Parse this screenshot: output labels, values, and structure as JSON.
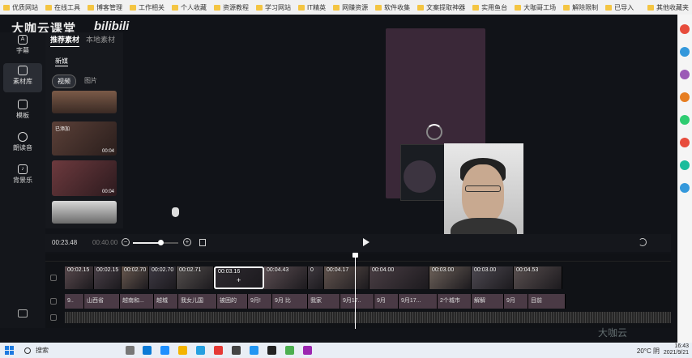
{
  "bookmarks": [
    {
      "label": "优质网站"
    },
    {
      "label": "在线工具"
    },
    {
      "label": "博客管理"
    },
    {
      "label": "工作相关"
    },
    {
      "label": "个人收藏"
    },
    {
      "label": "资源教程"
    },
    {
      "label": "学习网站"
    },
    {
      "label": "IT精英"
    },
    {
      "label": "网赚资源"
    },
    {
      "label": "软件收集"
    },
    {
      "label": "文案提取神器"
    },
    {
      "label": "实用鱼台"
    },
    {
      "label": "大咖哥工场"
    },
    {
      "label": "解除限制"
    },
    {
      "label": "已导入"
    }
  ],
  "bookmarks_right": "其他收藏夹",
  "app": {
    "brand": "大咖云课堂",
    "brand_logo": "bilibili"
  },
  "rail": [
    {
      "label": "字幕",
      "icon": "subtitle-icon"
    },
    {
      "label": "素材库",
      "icon": "library-icon"
    },
    {
      "label": "模板",
      "icon": "template-icon"
    },
    {
      "label": "朗读音",
      "icon": "voice-icon"
    },
    {
      "label": "背景乐",
      "icon": "music-icon"
    }
  ],
  "panel": {
    "tab_recommended": "推荐素材",
    "tab_local": "本地素材",
    "category": "新媒",
    "seg_video": "视频",
    "seg_image": "图片",
    "thumbs": [
      {
        "caption": "已添加",
        "duration": "00:04"
      },
      {
        "caption": "",
        "duration": "00:04"
      },
      {
        "caption": "",
        "duration": ""
      }
    ]
  },
  "player": {
    "current_time": "00:23.48",
    "total_time": "00:40.00",
    "zoom_level": 0.6
  },
  "timeline": {
    "clips": [
      {
        "label": "00:02.15",
        "selected": false
      },
      {
        "label": "00:02.15",
        "selected": false
      },
      {
        "label": "00:02.70",
        "selected": false
      },
      {
        "label": "00:02.70",
        "selected": false
      },
      {
        "label": "00:02.71",
        "selected": false
      },
      {
        "label": "00:03.16",
        "selected": true
      },
      {
        "label": "00:04.43",
        "selected": false
      },
      {
        "label": "0",
        "selected": false
      },
      {
        "label": "00:04.17",
        "selected": false
      },
      {
        "label": "00:04.00",
        "selected": false
      },
      {
        "label": "00:03.00",
        "selected": false
      },
      {
        "label": "00:03.00",
        "selected": false
      },
      {
        "label": "00:04.53",
        "selected": false
      }
    ],
    "text_clips": [
      "9..",
      "山西省",
      "越南和...",
      "越城",
      "我女儿国",
      "被困的",
      "9月!",
      "9月 比",
      "我家",
      "9月17..",
      "9月",
      "9月17...",
      "2个城市",
      "解解",
      "9月",
      "目前"
    ]
  },
  "watermark": "大咖云",
  "taskbar": {
    "search_placeholder": "搜索",
    "weather": "20°C 阴",
    "time": "16:43",
    "date": "2021/9/21"
  },
  "colors": {
    "app_bg": "#111318",
    "accent": "#ffffff",
    "preview_canvas": "#3a2838"
  }
}
